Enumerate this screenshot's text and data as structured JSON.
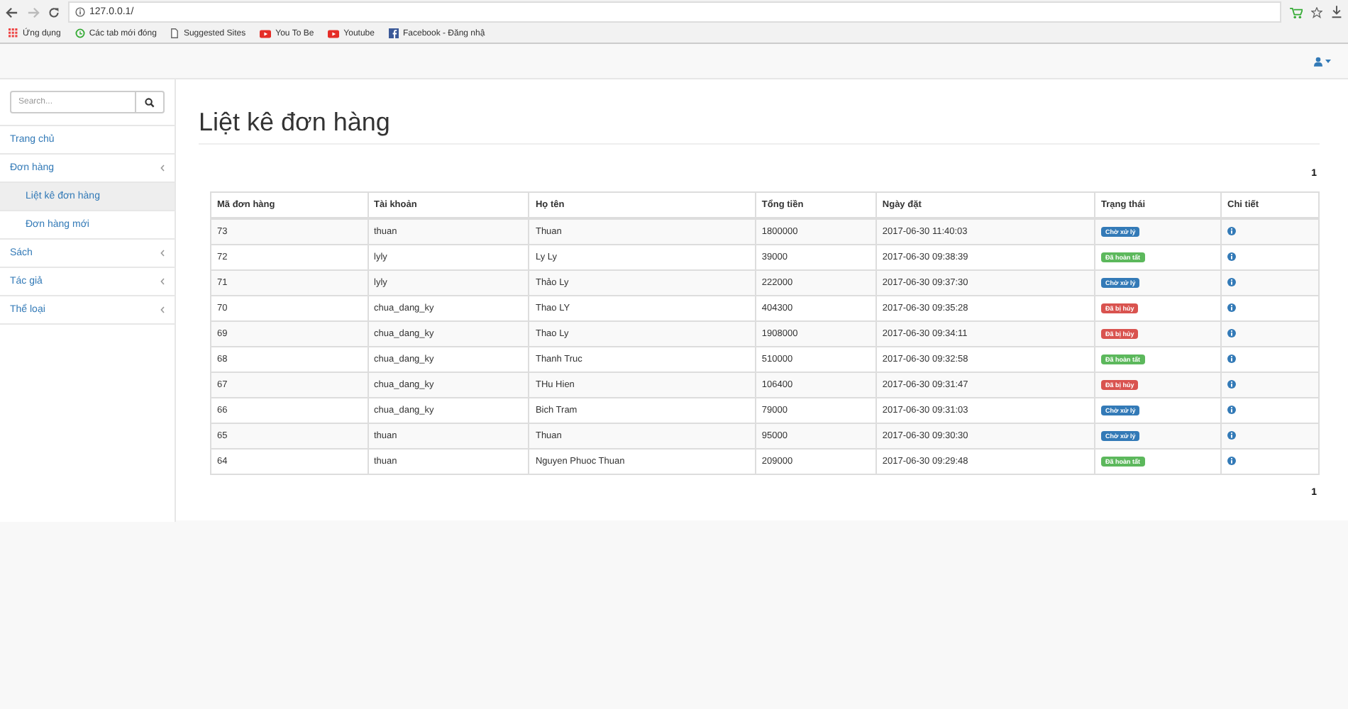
{
  "browser": {
    "url": "127.0.0.1/",
    "bookmarks": [
      {
        "kind": "apps",
        "label": "Ứng dụng"
      },
      {
        "kind": "history",
        "label": "Các tab mới đóng"
      },
      {
        "kind": "page",
        "label": "Suggested Sites"
      },
      {
        "kind": "video",
        "label": "You To Be"
      },
      {
        "kind": "video",
        "label": "Youtube"
      },
      {
        "kind": "social",
        "label": "Facebook - Đăng nhậ"
      }
    ]
  },
  "search": {
    "placeholder": "Search..."
  },
  "sidebar": {
    "items": [
      {
        "label": "Trang chủ",
        "selected": false
      },
      {
        "label": "Đơn hàng",
        "submenu": true,
        "expanded": true,
        "selected": false,
        "children": [
          {
            "label": "Liệt kê đơn hàng",
            "selected": true
          },
          {
            "label": "Đơn hàng mới",
            "selected": false
          }
        ]
      },
      {
        "label": "Sách",
        "submenu": true,
        "expanded": false,
        "selected": false
      },
      {
        "label": "Tác giả",
        "submenu": true,
        "expanded": false,
        "selected": false
      },
      {
        "label": "Thể loại",
        "submenu": true,
        "expanded": false,
        "selected": false
      }
    ]
  },
  "page_title": "Liệt kê đơn hàng",
  "pagination_top": [
    {
      "label": "1",
      "selected": true
    }
  ],
  "table": {
    "columns": [
      "Mã đơn hàng",
      "Tài khoản",
      "Họ tên",
      "Tổng tiền",
      "Ngày đặt",
      "Trạng thái",
      "Chi tiết"
    ],
    "rows": [
      {
        "id": "73",
        "account": "thuan",
        "name": "Thuan",
        "total": "1800000",
        "date": "2017-06-30 11:40:03",
        "status": {
          "label": "Chờ xử lý",
          "kind": "pending"
        }
      },
      {
        "id": "72",
        "account": "lyly",
        "name": "Ly Ly",
        "total": "39000",
        "date": "2017-06-30 09:38:39",
        "status": {
          "label": "Đã hoàn tất",
          "kind": "done"
        }
      },
      {
        "id": "71",
        "account": "lyly",
        "name": "Thảo Ly",
        "total": "222000",
        "date": "2017-06-30 09:37:30",
        "status": {
          "label": "Chờ xử lý",
          "kind": "pending"
        }
      },
      {
        "id": "70",
        "account": "chua_dang_ky",
        "name": "Thao LY",
        "total": "404300",
        "date": "2017-06-30 09:35:28",
        "status": {
          "label": "Đã bị hủy",
          "kind": "cancelled"
        }
      },
      {
        "id": "69",
        "account": "chua_dang_ky",
        "name": "Thao Ly",
        "total": "1908000",
        "date": "2017-06-30 09:34:11",
        "status": {
          "label": "Đã bị hủy",
          "kind": "cancelled"
        }
      },
      {
        "id": "68",
        "account": "chua_dang_ky",
        "name": "Thanh Truc",
        "total": "510000",
        "date": "2017-06-30 09:32:58",
        "status": {
          "label": "Đã hoàn tất",
          "kind": "done"
        }
      },
      {
        "id": "67",
        "account": "chua_dang_ky",
        "name": "THu Hien",
        "total": "106400",
        "date": "2017-06-30 09:31:47",
        "status": {
          "label": "Đã bị hủy",
          "kind": "cancelled"
        }
      },
      {
        "id": "66",
        "account": "chua_dang_ky",
        "name": "Bich Tram",
        "total": "79000",
        "date": "2017-06-30 09:31:03",
        "status": {
          "label": "Chờ xử lý",
          "kind": "pending"
        }
      },
      {
        "id": "65",
        "account": "thuan",
        "name": "Thuan",
        "total": "95000",
        "date": "2017-06-30 09:30:30",
        "status": {
          "label": "Chờ xử lý",
          "kind": "pending"
        }
      },
      {
        "id": "64",
        "account": "thuan",
        "name": "Nguyen Phuoc Thuan",
        "total": "209000",
        "date": "2017-06-30 09:29:48",
        "status": {
          "label": "Đã hoàn tất",
          "kind": "done"
        }
      }
    ]
  },
  "pagination_bottom": [
    {
      "label": "1",
      "selected": true
    }
  ]
}
